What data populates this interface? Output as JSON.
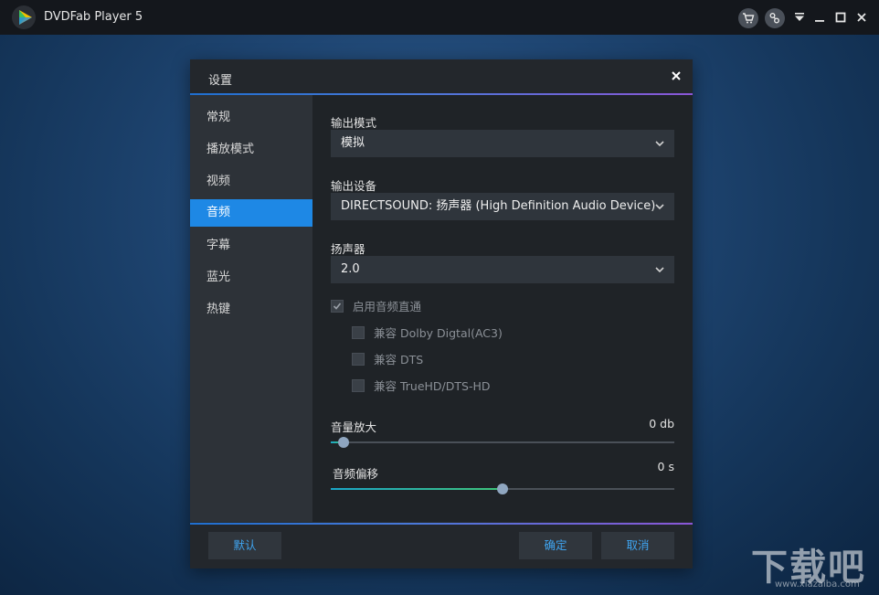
{
  "app": {
    "title": "DVDFab Player 5"
  },
  "titlebar": {
    "icons": [
      "cart-icon",
      "unlink-icon",
      "menu-triangle-icon",
      "minimize-icon",
      "maximize-icon",
      "close-icon"
    ]
  },
  "dialog": {
    "title": "设置",
    "sidebar": {
      "items": [
        {
          "label": "常规"
        },
        {
          "label": "播放模式"
        },
        {
          "label": "视频"
        },
        {
          "label": "音频",
          "active": true
        },
        {
          "label": "字幕"
        },
        {
          "label": "蓝光"
        },
        {
          "label": "热键"
        }
      ]
    },
    "audio": {
      "output_mode": {
        "label": "输出模式",
        "value": "模拟"
      },
      "output_device": {
        "label": "输出设备",
        "value": "DIRECTSOUND: 扬声器 (High Definition Audio Device)"
      },
      "speaker": {
        "label": "扬声器",
        "value": "2.0"
      },
      "passthrough": {
        "label": "启用音频直通",
        "checked": true,
        "options": [
          {
            "label": "兼容 Dolby Digtal(AC3)",
            "checked": false
          },
          {
            "label": "兼容 DTS",
            "checked": false
          },
          {
            "label": "兼容 TrueHD/DTS-HD",
            "checked": false
          }
        ]
      },
      "volume_boost": {
        "label": "音量放大",
        "value": "0 db",
        "level_percent": 3.7
      },
      "audio_offset": {
        "label": "音频偏移",
        "value": "0 s",
        "level_percent": 50
      }
    },
    "footer": {
      "default_label": "默认",
      "ok_label": "确定",
      "cancel_label": "取消"
    }
  },
  "watermark": {
    "text": "下载吧",
    "url": "www.xiazaiba.com"
  },
  "colors": {
    "accent": "#1e88e5",
    "button_text": "#3fa4f0"
  }
}
